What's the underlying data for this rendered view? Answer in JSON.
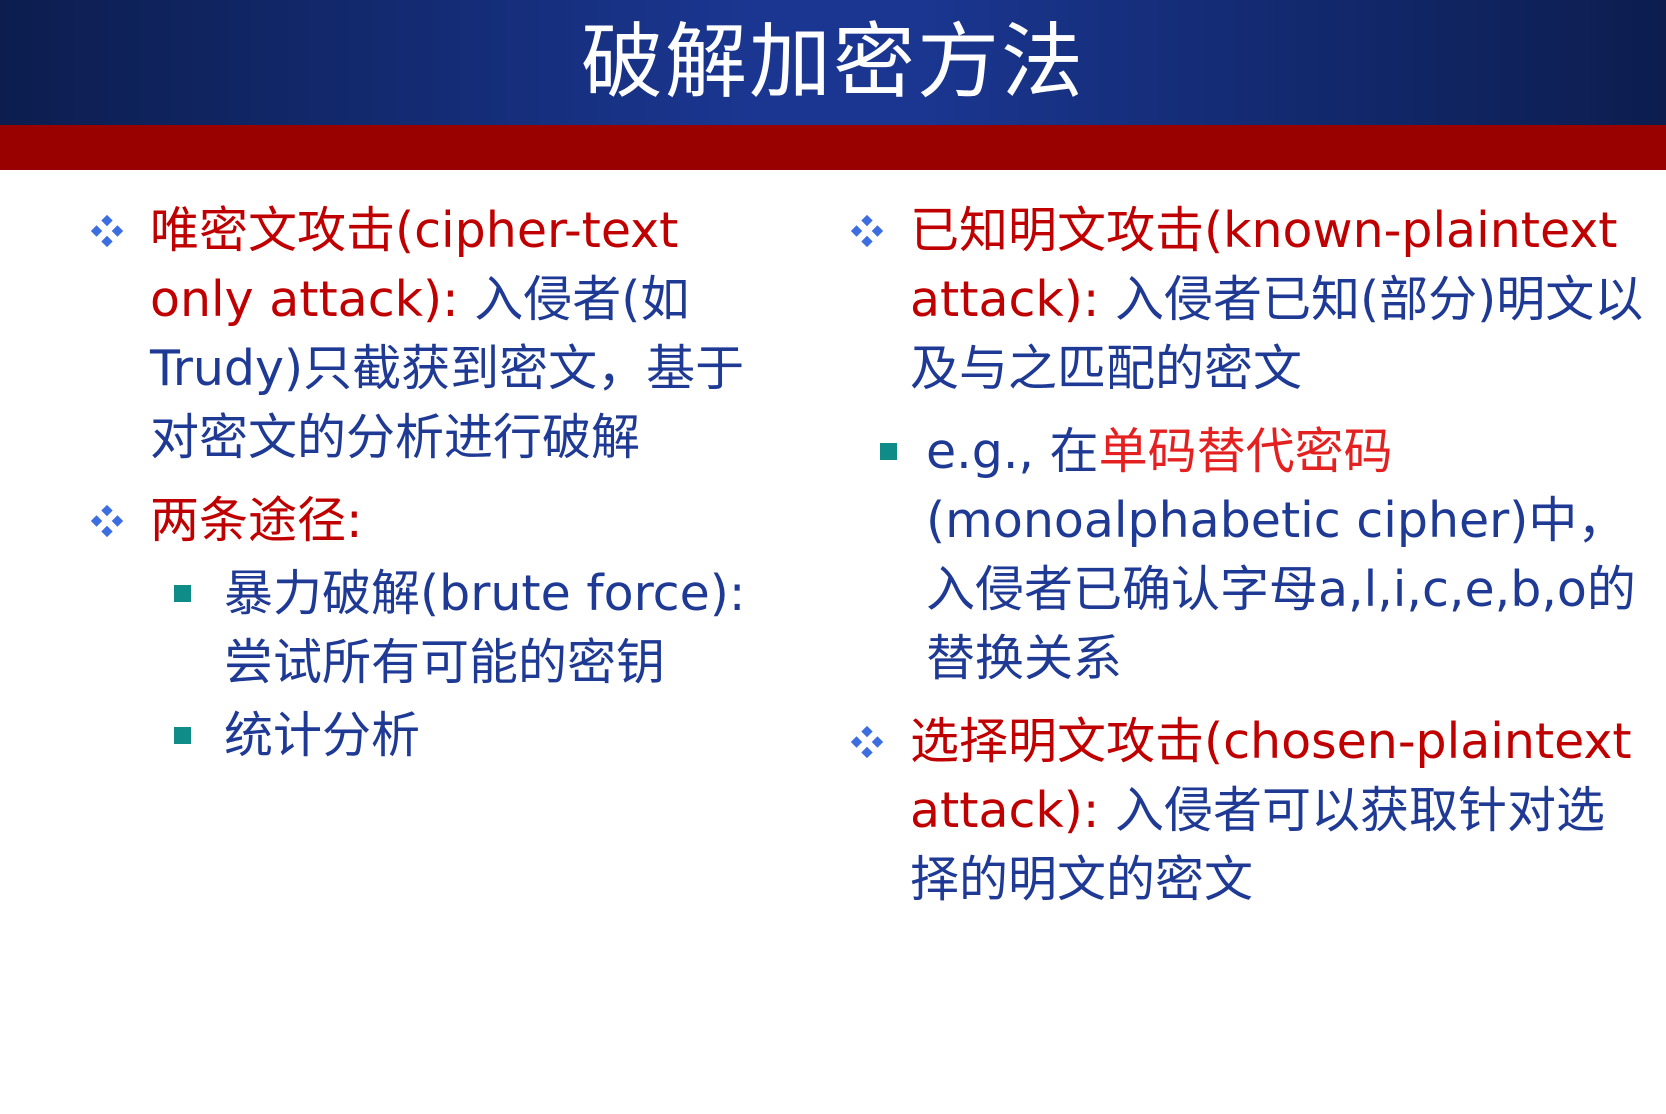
{
  "title": "破解加密方法",
  "left": {
    "ciphertext_only": {
      "term": "唯密文攻击(cipher-text only attack):",
      "desc": " 入侵者(如Trudy)只截获到密文，基于对密文的分析进行破解"
    },
    "two_ways": {
      "label": "两条途径:",
      "items": [
        {
          "text": "暴力破解(brute force): 尝试所有可能的密钥"
        },
        {
          "text": "统计分析"
        }
      ]
    }
  },
  "right": {
    "known_plaintext": {
      "term": "已知明文攻击(known-plaintext attack):",
      "desc": " 入侵者已知(部分)明文以及与之匹配的密文"
    },
    "example": {
      "prefix": "e.g., 在",
      "highlight": "单码替代密码",
      "suffix": "(monoalphabetic cipher)中，入侵者已确认字母a,l,i,c,e,b,o的替换关系"
    },
    "chosen_plaintext": {
      "term": "选择明文攻击(chosen-plaintext attack):",
      "desc": " 入侵者可以获取针对选择的明文的密文"
    }
  },
  "colors": {
    "title_bar": "#1a3690",
    "red_band": "#990000",
    "body_text": "#1f3a94",
    "term_red": "#c00000",
    "highlight_red": "#e52020",
    "bullet_blue": "#3c6ee0",
    "square_bullet": "#0f8c88"
  },
  "icons": {
    "level1_bullet": "diamond-cluster-icon",
    "level2_bullet": "square-bullet-icon"
  }
}
